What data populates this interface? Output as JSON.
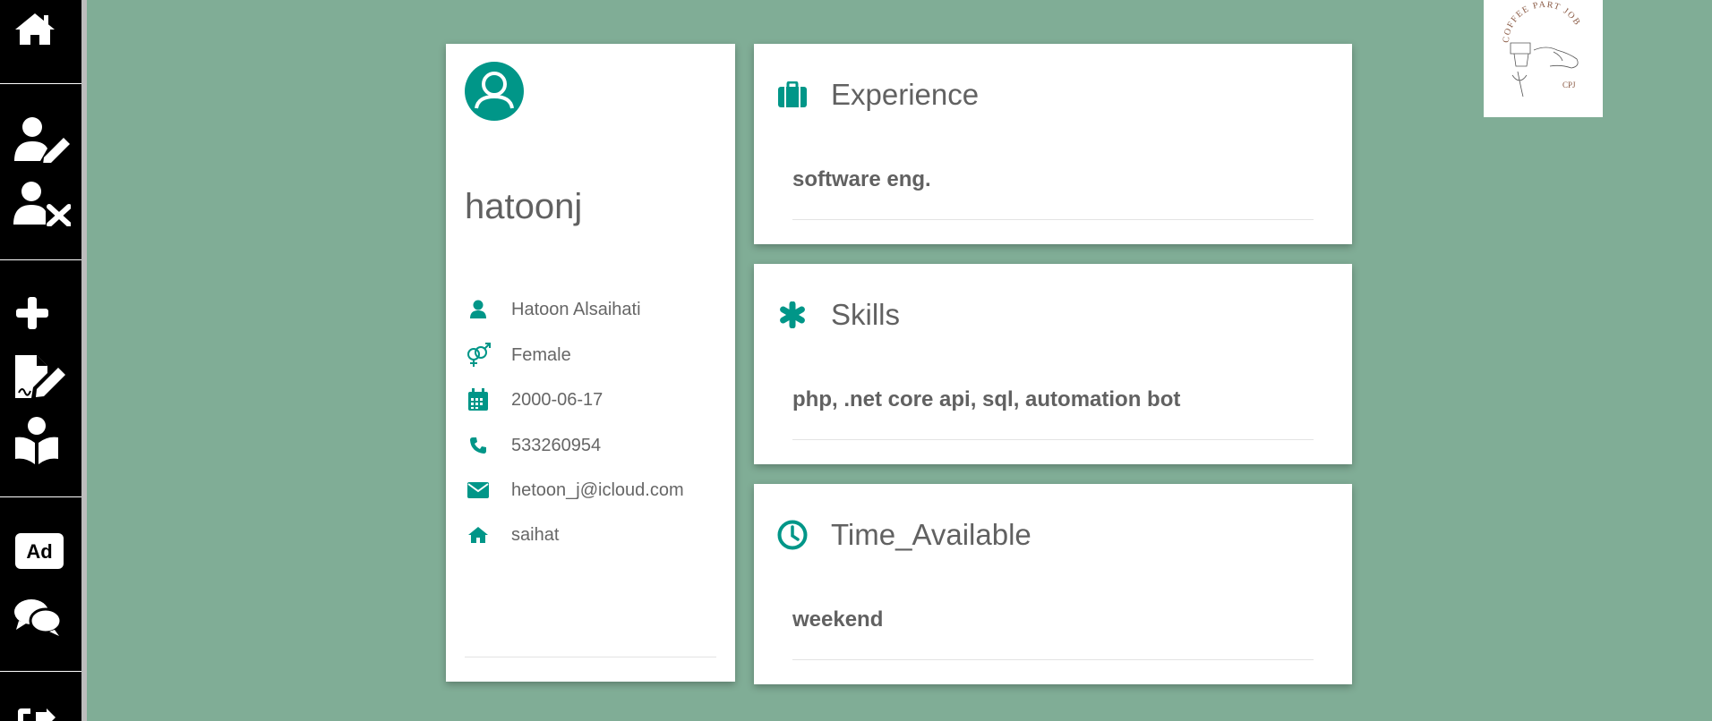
{
  "sidebar": {
    "items": [
      {
        "icon": "home-icon"
      },
      {
        "icon": "user-edit-icon"
      },
      {
        "icon": "user-remove-icon"
      },
      {
        "icon": "plus-icon"
      },
      {
        "icon": "file-signature-icon"
      },
      {
        "icon": "user-read-icon"
      },
      {
        "icon": "ad-icon",
        "label": "Ad"
      },
      {
        "icon": "chat-icon"
      },
      {
        "icon": "sign-out-icon"
      }
    ]
  },
  "profile": {
    "username": "hatoonj",
    "full_name": "Hatoon Alsaihati",
    "gender": "Female",
    "birthdate": "2000-06-17",
    "phone": "533260954",
    "email": "hetoon_j@icloud.com",
    "city": "saihat"
  },
  "sections": {
    "experience": {
      "title": "Experience",
      "value": "software eng."
    },
    "skills": {
      "title": "Skills",
      "value": "php, .net core api, sql, automation bot"
    },
    "time": {
      "title": "Time_Available",
      "value": "weekend"
    }
  },
  "logo": {
    "text_arc": "COFFEE PART JOB",
    "initials": "CPJ"
  },
  "colors": {
    "background": "#80ad96",
    "accent": "#009688",
    "sidebar": "#000000",
    "text": "#616161"
  }
}
